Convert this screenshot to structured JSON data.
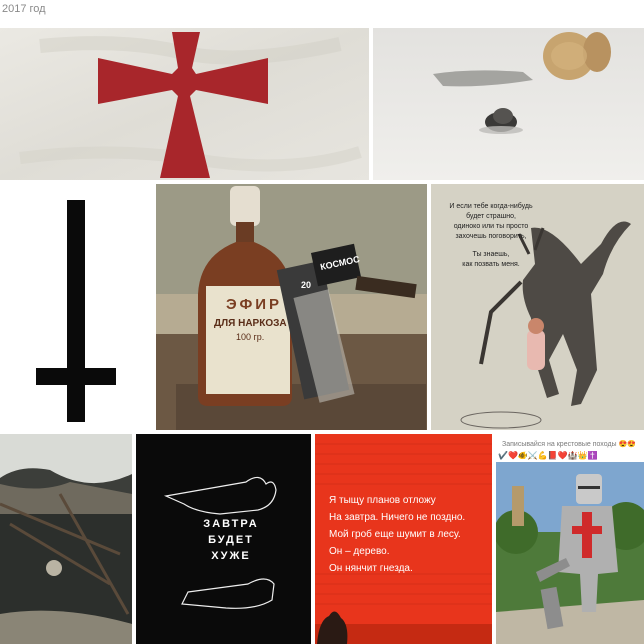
{
  "header": {
    "year_label": "2017 год"
  },
  "photos": [
    {
      "name": "templar-cross-flag",
      "kind": "image"
    },
    {
      "name": "cork-and-ash",
      "kind": "image"
    },
    {
      "name": "inverted-cross",
      "kind": "image"
    },
    {
      "name": "ether-bottle",
      "kind": "image",
      "bottle_label": "ЭФИР",
      "bottle_sublabel": "ДЛЯ НАРКОЗА",
      "bottle_volume": "100 гр.",
      "box_label": "КОСМОС",
      "box_number": "20"
    },
    {
      "name": "demon-comic",
      "kind": "image",
      "lines": [
        "И если тебе когда-нибудь",
        "будет страшно,",
        "одиноко или ты просто",
        "захочешь поговорить,",
        "Ты знаешь,",
        "как позвать меня."
      ]
    },
    {
      "name": "winter-pond-skull",
      "kind": "image"
    },
    {
      "name": "tomorrow-worse",
      "kind": "image",
      "lines": [
        "ЗАВТРА",
        "БУДЕТ",
        "ХУЖЕ"
      ]
    },
    {
      "name": "red-poem",
      "kind": "image",
      "lines": [
        "Я тыщу планов отложу",
        "На завтра. Ничего не поздно.",
        "Мой гроб еще шумит в лесу.",
        "Он – дерево.",
        "Он нянчит гнезда."
      ]
    },
    {
      "name": "knight-park",
      "kind": "image",
      "caption": "Записывайся на крестовые походы",
      "emoji_caption": "😍😍",
      "emoji_row": "✔️❤️🐠⚔️💪📕❤️🏰👑✝️"
    }
  ],
  "colors": {
    "cross_red": "#a8262b",
    "flag_bg": "#e3e1da",
    "ash_bg": "#ecebe8",
    "cork": "#c7a46f",
    "black": "#0a0a0a",
    "poem_red": "#e8351c",
    "comic_bg": "#d5d2c5"
  }
}
